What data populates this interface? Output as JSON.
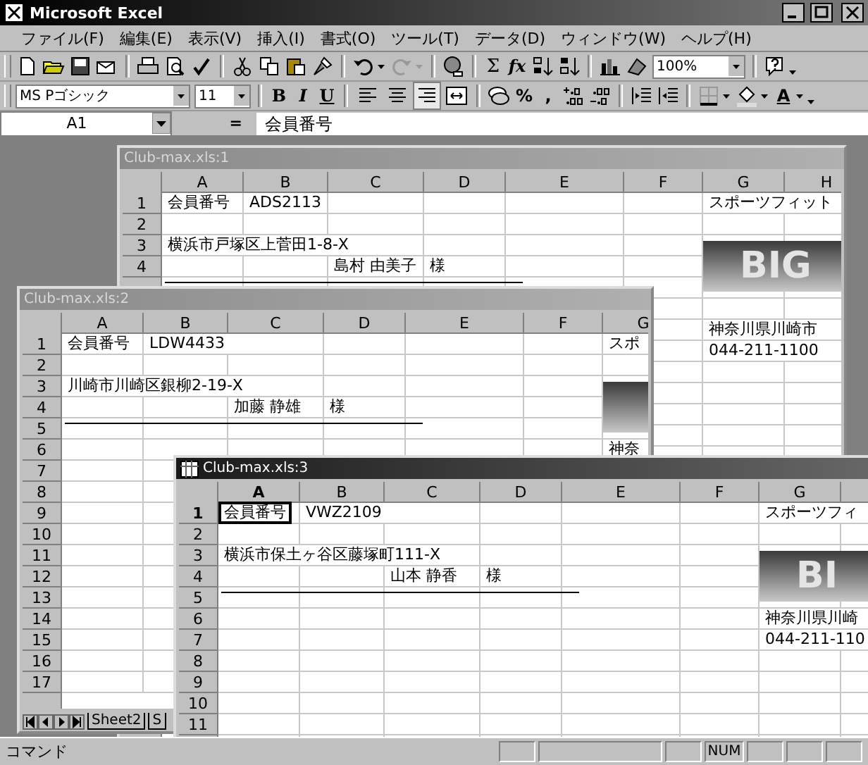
{
  "window": {
    "title": "Microsoft Excel"
  },
  "menu": [
    "ファイル(F)",
    "編集(E)",
    "表示(V)",
    "挿入(I)",
    "書式(O)",
    "ツール(T)",
    "データ(D)",
    "ウィンドウ(W)",
    "ヘルプ(H)"
  ],
  "standard_toolbar": {
    "redo": {
      "disabled": true
    },
    "sum_label": "Σ",
    "function_label": "fx",
    "zoom": "100%"
  },
  "formatting_toolbar": {
    "font": "MS Pゴシック",
    "size": "11",
    "style_buttons": [
      "B",
      "I",
      "U"
    ],
    "alignment_buttons": [
      {
        "kind": "left",
        "selected": false
      },
      {
        "kind": "center",
        "selected": false
      },
      {
        "kind": "right",
        "selected": true
      },
      {
        "kind": "merge",
        "selected": false
      }
    ],
    "number_labels": [
      "%",
      ","
    ],
    "font_color_label": "A"
  },
  "formula_bar": {
    "name_box": "A1",
    "equals": "=",
    "value": "会員番号"
  },
  "workbooks": [
    {
      "title": "Club-max.xls:1",
      "active": false,
      "columns": [
        "A",
        "B",
        "C",
        "D",
        "E",
        "F",
        "G",
        "H"
      ],
      "logo": {
        "visible": true,
        "text": "BIG"
      },
      "signature_line": true,
      "rows": [
        {
          "number": "1",
          "cells": [
            {
              "text": "会員番号",
              "selected": false
            },
            {
              "text": "ADS2113",
              "selected": false
            },
            null,
            null,
            null,
            null,
            {
              "text": "スポーツフィット",
              "selected": false
            },
            null
          ]
        },
        {
          "number": "2",
          "cells": []
        },
        {
          "number": "3",
          "cells": [
            {
              "text": "横浜市戸塚区上菅田1-8-X",
              "selected": false
            }
          ]
        },
        {
          "number": "4",
          "cells": [
            null,
            null,
            {
              "text": "島村 由美子",
              "selected": false
            },
            {
              "text": "様",
              "selected": false
            }
          ]
        },
        {
          "cells": []
        },
        {
          "cells": []
        },
        {
          "cells": [
            null,
            null,
            null,
            null,
            null,
            null,
            {
              "text": "神奈川県川崎市",
              "selected": false
            }
          ]
        },
        {
          "cells": [
            null,
            null,
            null,
            null,
            null,
            null,
            {
              "text": "044-211-1100",
              "selected": false
            }
          ]
        }
      ]
    },
    {
      "title": "Club-max.xls:2",
      "active": false,
      "columns": [
        "A",
        "B",
        "C",
        "D",
        "E",
        "F",
        "G"
      ],
      "logo": {
        "visible": true
      },
      "signature_line": true,
      "rows": [
        {
          "number": "1",
          "cells": [
            {
              "text": "会員番号",
              "selected": false
            },
            {
              "text": "LDW4433",
              "selected": false
            },
            null,
            null,
            null,
            null,
            {
              "text": "スポ",
              "selected": false
            }
          ]
        },
        {
          "number": "2",
          "cells": []
        },
        {
          "number": "3",
          "cells": [
            {
              "text": "川崎市川崎区銀柳2-19-X",
              "selected": false
            }
          ]
        },
        {
          "number": "4",
          "cells": [
            null,
            null,
            {
              "text": "加藤 静雄",
              "selected": false
            },
            {
              "text": "様",
              "selected": false
            }
          ]
        },
        {
          "number": "5",
          "cells": []
        },
        {
          "number": "6",
          "cells": [
            null,
            null,
            null,
            null,
            null,
            null,
            {
              "text": "神奈",
              "selected": false
            }
          ]
        },
        {
          "number": "7",
          "cells": []
        },
        {
          "number": "8",
          "cells": []
        },
        {
          "number": "9",
          "cells": []
        },
        {
          "number": "10",
          "cells": []
        },
        {
          "number": "11",
          "cells": []
        },
        {
          "number": "12",
          "cells": []
        },
        {
          "number": "13",
          "cells": []
        },
        {
          "number": "14",
          "cells": []
        },
        {
          "number": "15",
          "cells": []
        },
        {
          "number": "16",
          "cells": []
        },
        {
          "number": "17",
          "cells": []
        }
      ],
      "sheet_tabs": [
        {
          "label": "Sheet2",
          "selected": false
        },
        {
          "label": "S",
          "selected": false
        }
      ]
    },
    {
      "title": "Club-max.xls:3",
      "active": true,
      "columns": [
        "A",
        "B",
        "C",
        "D",
        "E",
        "F",
        "G"
      ],
      "logo": {
        "visible": true,
        "text": "BI"
      },
      "signature_line": true,
      "rows": [
        {
          "number": "1",
          "cells": [
            {
              "text": "会員番号",
              "selected": true
            },
            {
              "text": "VWZ2109",
              "selected": false
            },
            null,
            null,
            null,
            null,
            {
              "text": "スポーツフィ",
              "selected": false
            }
          ]
        },
        {
          "number": "2",
          "cells": []
        },
        {
          "number": "3",
          "cells": [
            {
              "text": "横浜市保土ヶ谷区藤塚町111-X",
              "selected": false
            }
          ]
        },
        {
          "number": "4",
          "cells": [
            null,
            null,
            {
              "text": "山本 静香",
              "selected": false
            },
            {
              "text": "様",
              "selected": false
            }
          ]
        },
        {
          "number": "5",
          "cells": []
        },
        {
          "number": "6",
          "cells": [
            null,
            null,
            null,
            null,
            null,
            null,
            {
              "text": "神奈川県川崎",
              "selected": false
            }
          ]
        },
        {
          "number": "7",
          "cells": [
            null,
            null,
            null,
            null,
            null,
            null,
            {
              "text": "044-211-110",
              "selected": false
            }
          ]
        },
        {
          "number": "8",
          "cells": []
        },
        {
          "number": "9",
          "cells": []
        },
        {
          "number": "10",
          "cells": []
        },
        {
          "number": "11",
          "cells": []
        }
      ]
    }
  ],
  "status_bar": {
    "text": "コマンド",
    "indicators": [
      "NUM"
    ]
  }
}
